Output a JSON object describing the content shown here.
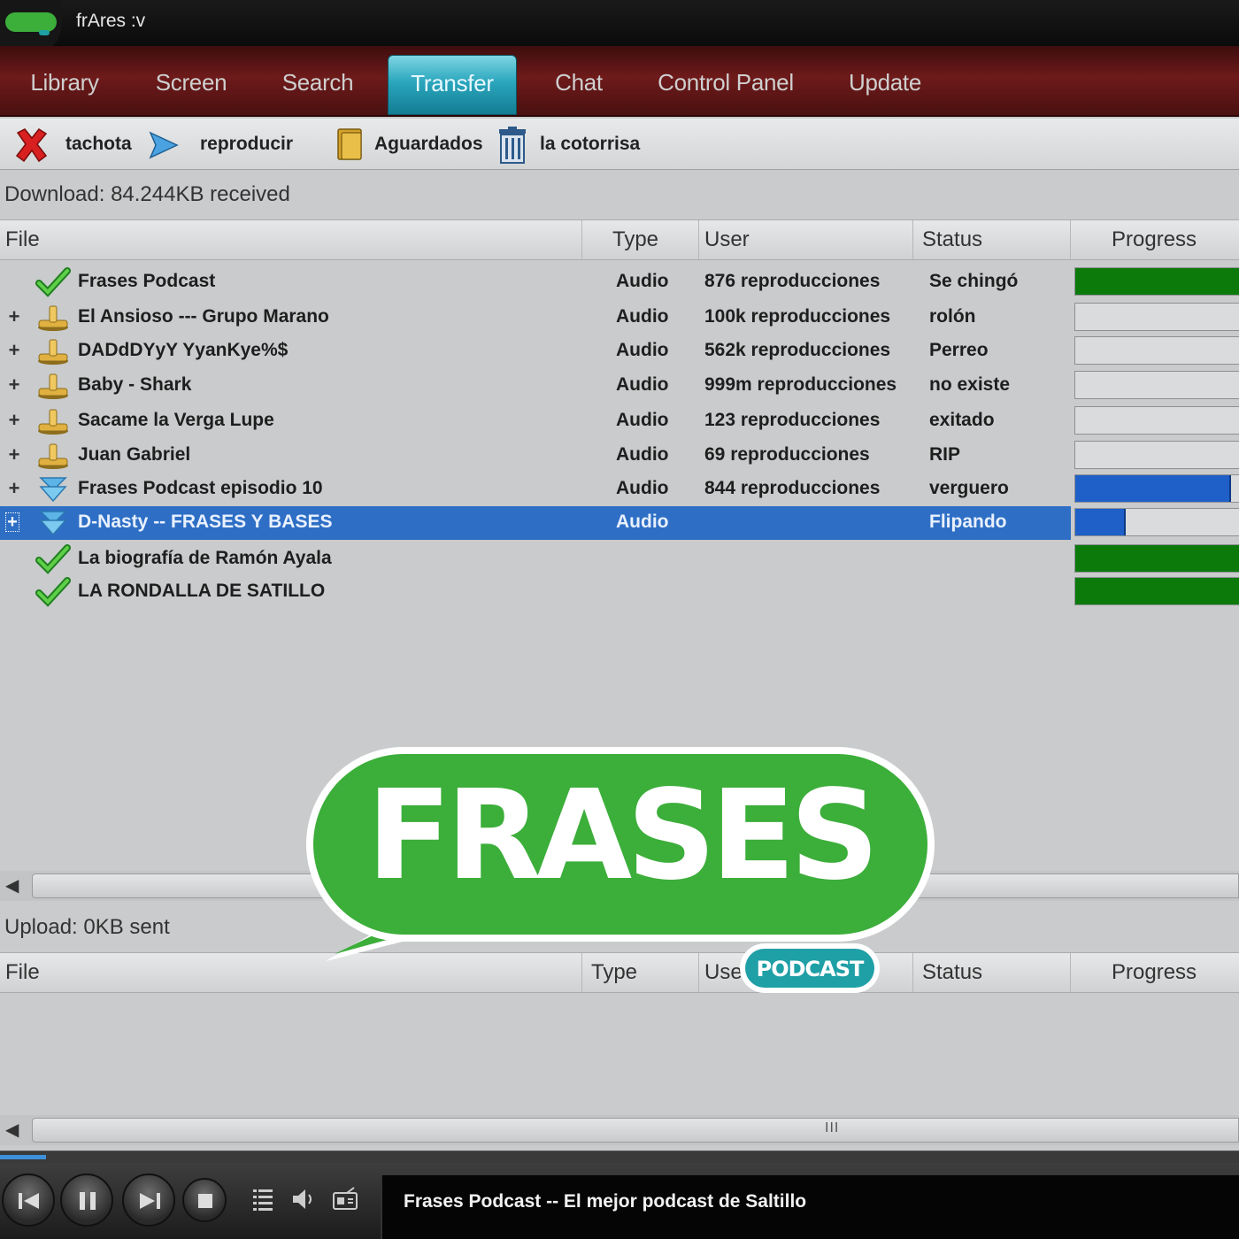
{
  "window": {
    "title": "frAres :v"
  },
  "tabs": [
    {
      "label": "Library"
    },
    {
      "label": "Screen"
    },
    {
      "label": "Search"
    },
    {
      "label": "Transfer"
    },
    {
      "label": "Chat"
    },
    {
      "label": "Control Panel"
    },
    {
      "label": "Update"
    }
  ],
  "toolbar": {
    "delete_label": "tachota",
    "play_label": "reproducir",
    "saved_label": "Aguardados",
    "clear_label": "la cotorrisa"
  },
  "download": {
    "status": "Download: 84.244KB received",
    "columns": {
      "file": "File",
      "type": "Type",
      "user": "User",
      "status": "Status",
      "progress": "Progress"
    },
    "rows": [
      {
        "expander": "",
        "icon": "check-icon",
        "file": "Frases Podcast",
        "type": "Audio",
        "user": "876 reproducciones",
        "status": "Se chingó",
        "progress": 1.0,
        "color": "#0b7a0b"
      },
      {
        "expander": "+",
        "icon": "hub-icon",
        "file": "El Ansioso --- Grupo Marano",
        "type": "Audio",
        "user": "100k reproducciones",
        "status": "rolón",
        "progress": 0,
        "color": "#0b7a0b"
      },
      {
        "expander": "+",
        "icon": "hub-icon",
        "file": "DADdDYyY YyanKye%$",
        "type": "Audio",
        "user": "562k reproducciones",
        "status": "Perreo",
        "progress": 0,
        "color": "#0b7a0b"
      },
      {
        "expander": "+",
        "icon": "hub-icon",
        "file": "Baby - Shark",
        "type": "Audio",
        "user": "999m reproducciones",
        "status": "no existe",
        "progress": 0,
        "color": "#0b7a0b"
      },
      {
        "expander": "+",
        "icon": "hub-icon",
        "file": "Sacame la Verga Lupe",
        "type": "Audio",
        "user": "123 reproducciones",
        "status": "exitado",
        "progress": 0,
        "color": "#0b7a0b"
      },
      {
        "expander": "+",
        "icon": "hub-icon",
        "file": "Juan Gabriel",
        "type": "Audio",
        "user": "69 reproducciones",
        "status": "RIP",
        "progress": 0,
        "color": "#0b7a0b"
      },
      {
        "expander": "+",
        "icon": "download-arrow-icon",
        "file": "Frases Podcast episodio 10",
        "type": "Audio",
        "user": "844 reproducciones",
        "status": "verguero",
        "progress": 0.95,
        "color": "#1f5fc8"
      },
      {
        "expander": "+",
        "icon": "download-arrow-icon",
        "file": "D-Nasty -- FRASES Y BASES",
        "type": "Audio",
        "user": "",
        "status": "Flipando",
        "progress": 0.31,
        "color": "#1f5fc8",
        "selected": true
      },
      {
        "expander": "",
        "icon": "check-icon",
        "file": "La biografía de Ramón Ayala",
        "type": "",
        "user": "",
        "status": "",
        "progress": 1.0,
        "color": "#0b7a0b"
      },
      {
        "expander": "",
        "icon": "check-icon",
        "file": "LA RONDALLA DE SATILLO",
        "type": "",
        "user": "",
        "status": "",
        "progress": 1.0,
        "color": "#0b7a0b"
      }
    ]
  },
  "upload": {
    "status": "Upload: 0KB sent",
    "columns": {
      "file": "File",
      "type": "Type",
      "user": "User",
      "status": "Status",
      "progress": "Progress"
    }
  },
  "scrollbar": {
    "grip": "III"
  },
  "player": {
    "now_playing": "Frases Podcast -- El mejor podcast de Saltillo",
    "seek_position": 0.037
  },
  "overlay_logo": {
    "word": "FRASES",
    "badge": "PODCAST"
  },
  "colors": {
    "tab_active": "#2aa6bd",
    "progress_green": "#0b7a0b",
    "progress_blue": "#1f5fc8",
    "selection": "#2e6fc5",
    "logo_green": "#3cae3a",
    "logo_teal": "#1f9fa6"
  }
}
